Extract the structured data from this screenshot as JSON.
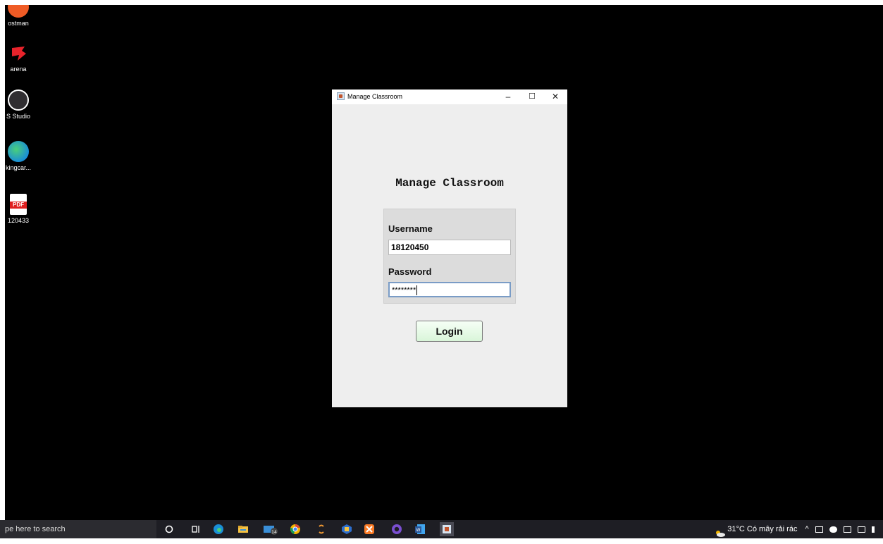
{
  "desktop": {
    "icons": [
      {
        "label": "ostman",
        "icon": "postman-icon",
        "color": "#ef5b25"
      },
      {
        "label": "arena",
        "icon": "garena-icon",
        "color": "#e8232b"
      },
      {
        "label": "S Studio",
        "icon": "obs-studio-icon",
        "color": "#302e31"
      },
      {
        "label": "kingcar...",
        "icon": "edge-icon",
        "color": "#1a8fd6"
      },
      {
        "label": "120433",
        "icon": "pdf-icon",
        "color": "#e02020"
      }
    ]
  },
  "window": {
    "title": "Manage Classroom",
    "controls": {
      "minimize": "–",
      "maximize": "☐",
      "close": "✕"
    },
    "heading": "Manage Classroom",
    "form": {
      "username_label": "Username",
      "username_value": "18120450",
      "password_label": "Password",
      "password_value": "********"
    },
    "login_button": "Login"
  },
  "taskbar": {
    "search_placeholder": "pe here to search",
    "apps": [
      {
        "name": "cortana-icon",
        "color": "#ffffff"
      },
      {
        "name": "task-view-icon",
        "color": "#ffffff"
      },
      {
        "name": "edge-icon",
        "color": "#1a8fd6"
      },
      {
        "name": "file-explorer-icon",
        "color": "#f5c242"
      },
      {
        "name": "mail-icon",
        "color": "#3a8fd8"
      },
      {
        "name": "chrome-icon",
        "color": "#f4b400"
      },
      {
        "name": "sublime-icon",
        "color": "#f29a32"
      },
      {
        "name": "virtualbox-icon",
        "color": "#2d6fcf"
      },
      {
        "name": "xampp-icon",
        "color": "#fb7a24"
      },
      {
        "name": "github-desktop-icon",
        "color": "#7a4fd1"
      },
      {
        "name": "word-icon",
        "color": "#2b5797"
      },
      {
        "name": "java-app-icon",
        "color": "#c2552d"
      }
    ],
    "weather": "31°C  Có mây rải rác",
    "tray_chevron": "^"
  }
}
